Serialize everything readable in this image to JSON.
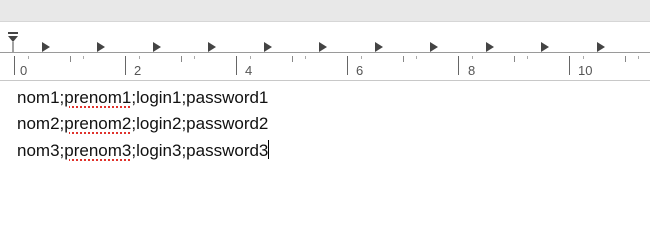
{
  "ruler": {
    "tick_labels": [
      "0",
      "2",
      "4",
      "6",
      "8",
      "10"
    ],
    "icons": [
      "tab-stop-marker-icon",
      "indent-marker-icon"
    ]
  },
  "document": {
    "lines": [
      {
        "before": "nom1;",
        "misspelled": "prenom1",
        "after": ";login1;password1"
      },
      {
        "before": "nom2;",
        "misspelled": "prenom2",
        "after": ";login2;password2"
      },
      {
        "before": "nom3;",
        "misspelled": "prenom3",
        "after": ";login3;password3"
      }
    ],
    "spellcheck_color": "#e0322c"
  }
}
